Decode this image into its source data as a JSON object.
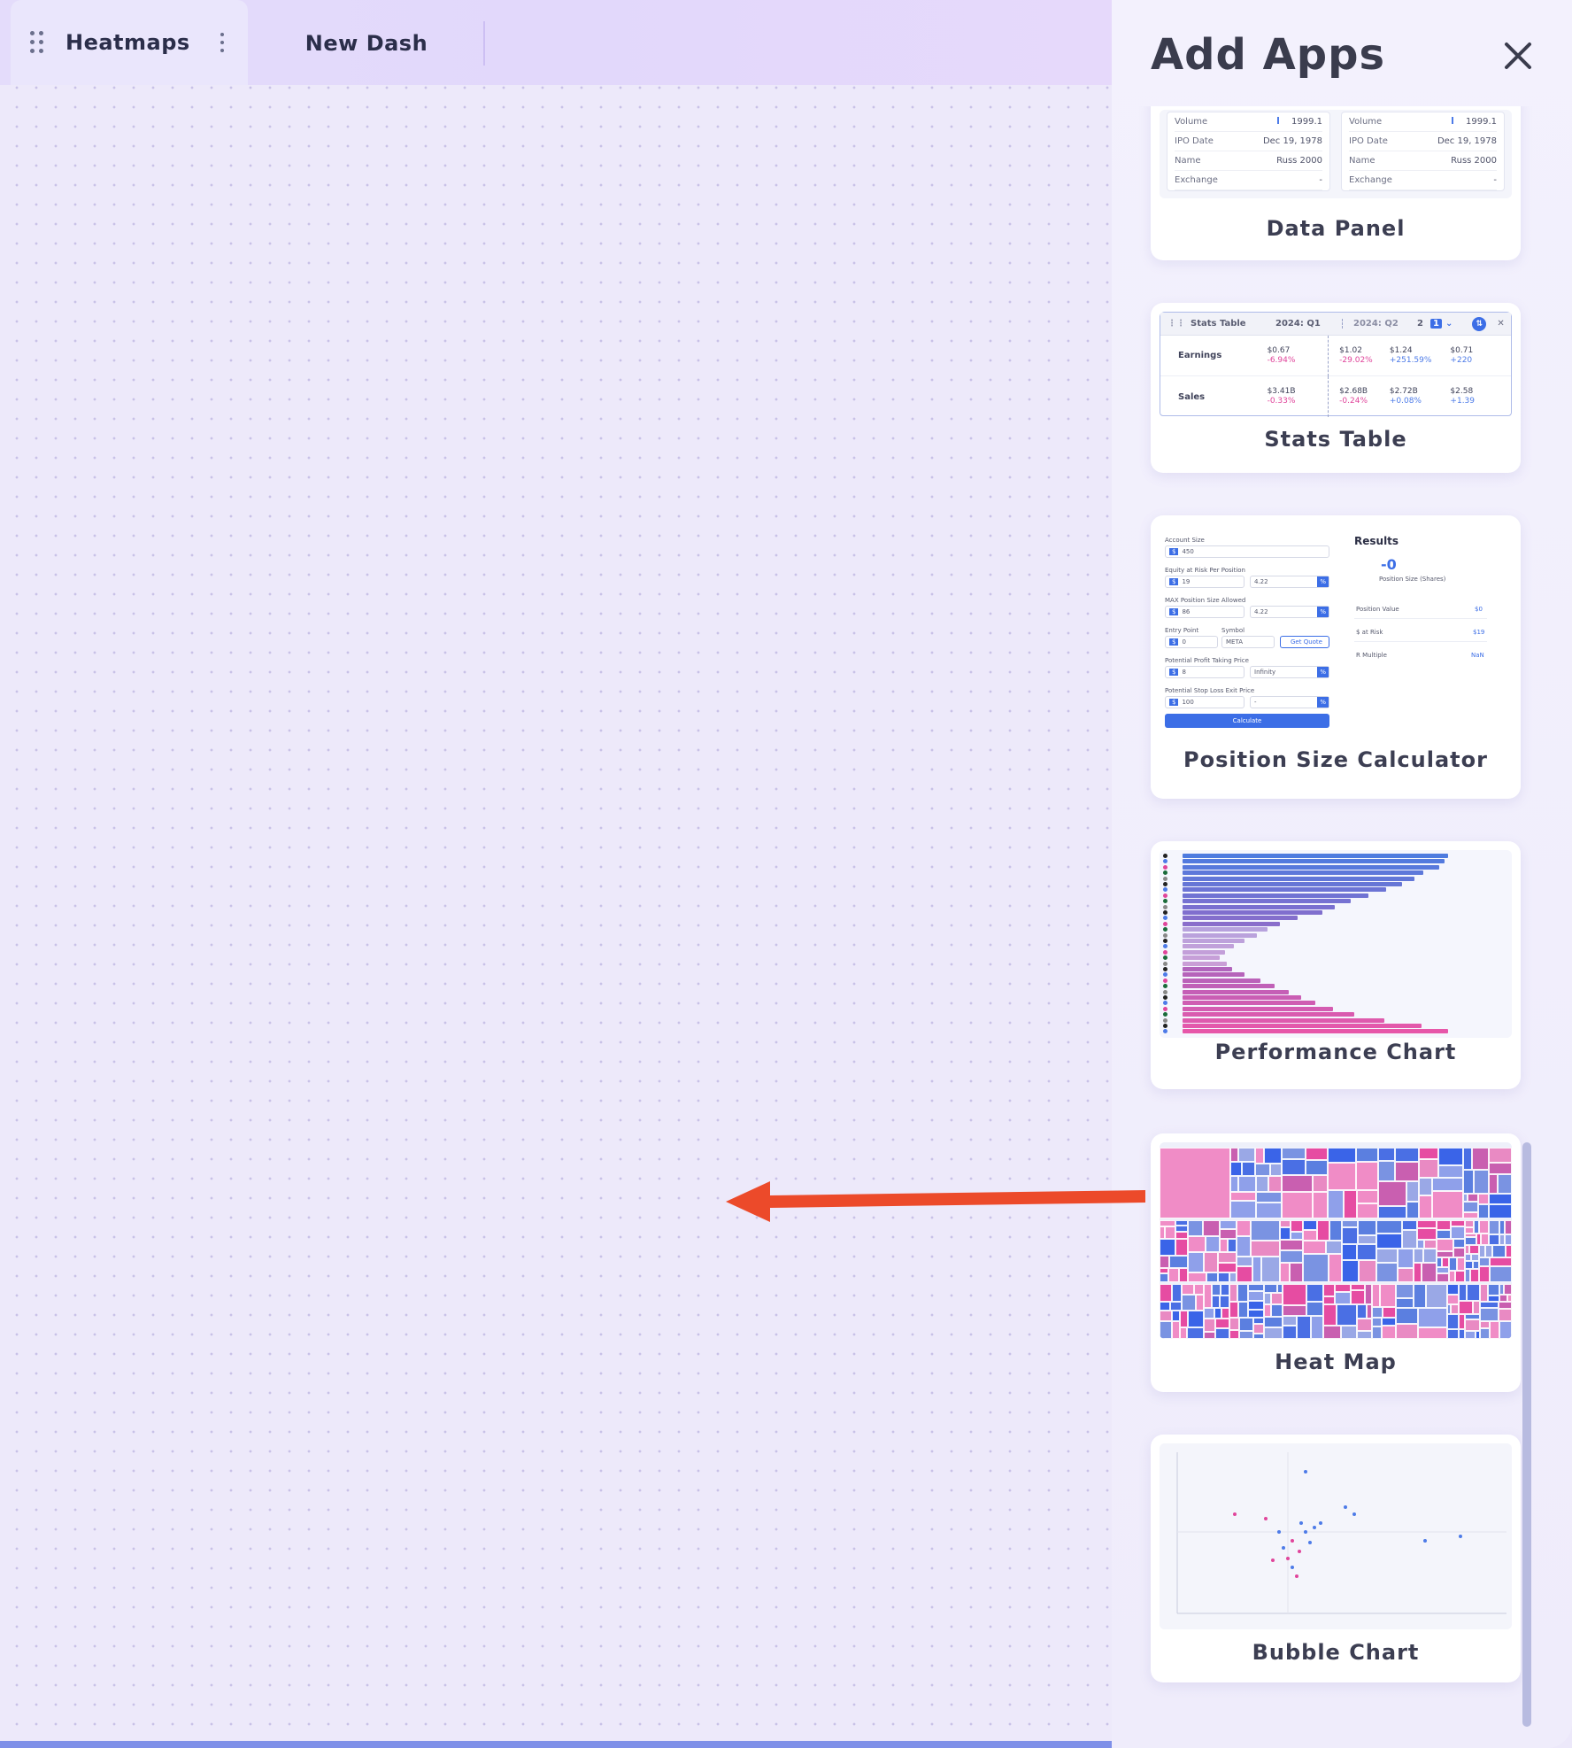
{
  "tabs": {
    "active_label": "Heatmaps",
    "inactive_label": "New Dash"
  },
  "panel": {
    "title": "Add Apps",
    "close_label": "×"
  },
  "apps": [
    {
      "name": "Data Panel"
    },
    {
      "name": "Stats Table"
    },
    {
      "name": "Position Size Calculator"
    },
    {
      "name": "Performance Chart"
    },
    {
      "name": "Heat Map"
    },
    {
      "name": "Bubble Chart"
    }
  ],
  "data_panel_thumb": {
    "rows": [
      {
        "label": "Volume",
        "value": "1999.1"
      },
      {
        "label": "IPO Date",
        "value": "Dec 19, 1978"
      },
      {
        "label": "Name",
        "value": "Russ 2000"
      },
      {
        "label": "Exchange",
        "value": "-"
      }
    ]
  },
  "stats_table_thumb": {
    "title": "Stats Table",
    "q1": "2024: Q1",
    "q2": "2024: Q2",
    "count": "2",
    "badge": "1",
    "rows": [
      {
        "label": "Earnings",
        "c1a": "$0.67",
        "c1b": "-6.94%",
        "c2a": "$1.02",
        "c2b": "-29.02%",
        "c3a": "$1.24",
        "c3b": "+251.59%",
        "c4a": "$0.71",
        "c4b": "+220"
      },
      {
        "label": "Sales",
        "c1a": "$3.41B",
        "c1b": "-0.33%",
        "c2a": "$2.68B",
        "c2b": "-0.24%",
        "c3a": "$2.72B",
        "c3b": "+0.08%",
        "c4a": "$2.58",
        "c4b": "+1.39"
      }
    ]
  },
  "calculator_thumb": {
    "account_size_label": "Account Size",
    "account_size": "450",
    "equity_label": "Equity at Risk Per Position",
    "equity_a": "19",
    "equity_b": "4.22",
    "max_label": "MAX Position Size Allowed",
    "max_a": "86",
    "max_b": "4.22",
    "entry_label": "Entry Point",
    "symbol_label": "Symbol",
    "entry": "0",
    "symbol": "META",
    "quote_button": "Get Quote",
    "profit_label": "Potential Profit Taking Price",
    "profit_a": "8",
    "profit_b": "Infinity",
    "stop_label": "Potential Stop Loss Exit Price",
    "stop_a": "100",
    "stop_b": "-",
    "calculate_button": "Calculate",
    "results_title": "Results",
    "result_value": "-0",
    "result_caption": "Position Size (Shares)",
    "position_value_label": "Position Value",
    "position_value": "$0",
    "risk_label": "$ at Risk",
    "risk_value": "$19",
    "r_multiple_label": "R Multiple",
    "r_multiple_value": "NaN",
    "currency": "$",
    "percent": "%"
  },
  "colors": {
    "accent_blue": "#3c6ee6",
    "accent_pink": "#e0459b",
    "arrow_red": "#ec4a2a"
  }
}
